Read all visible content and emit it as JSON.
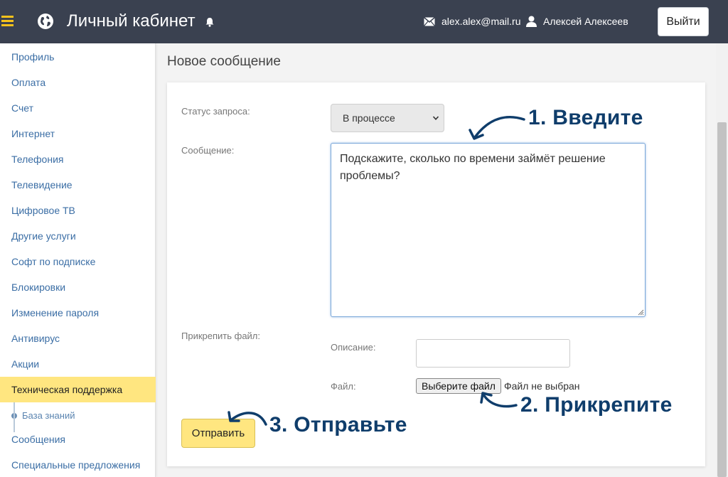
{
  "header": {
    "title": "Личный кабинет",
    "email": "alex.alex@mail.ru",
    "user_name": "Алексей Алексеев",
    "logout_label": "Выйти"
  },
  "sidebar": {
    "items": [
      {
        "label": "Профиль"
      },
      {
        "label": "Оплата"
      },
      {
        "label": "Счет"
      },
      {
        "label": "Интернет"
      },
      {
        "label": "Телефония"
      },
      {
        "label": "Телевидение"
      },
      {
        "label": "Цифровое ТВ"
      },
      {
        "label": "Другие услуги"
      },
      {
        "label": "Софт по подписке"
      },
      {
        "label": "Блокировки"
      },
      {
        "label": "Изменение пароля"
      },
      {
        "label": "Антивирус"
      },
      {
        "label": "Акции"
      },
      {
        "label": "Техническая поддержка",
        "active": true
      },
      {
        "label": "Сообщения"
      },
      {
        "label": "Специальные предложения"
      }
    ],
    "sub_item": {
      "label": "База знаний"
    }
  },
  "main": {
    "page_title": "Новое сообщение",
    "form": {
      "status_label": "Статус запроса:",
      "status_value": "В процессе",
      "message_label": "Сообщение:",
      "message_value": "Подскажите, сколько по времени займёт решение проблемы?",
      "attach_label": "Прикрепить файл:",
      "description_label": "Описание:",
      "description_value": "",
      "file_label": "Файл:",
      "file_button_label": "Выберите файл",
      "file_status": "Файл не выбран",
      "send_label": "Отправить"
    }
  },
  "annotations": {
    "step1": "1. Введите",
    "step2": "2. Прикрепите",
    "step3": "3. Отправьте"
  },
  "colors": {
    "header_bg": "#3a4150",
    "accent_yellow": "#ffe680",
    "hamburger_yellow": "#f5c21b",
    "link_blue": "#3b6ea5",
    "annotation_blue": "#0f3d6b"
  }
}
